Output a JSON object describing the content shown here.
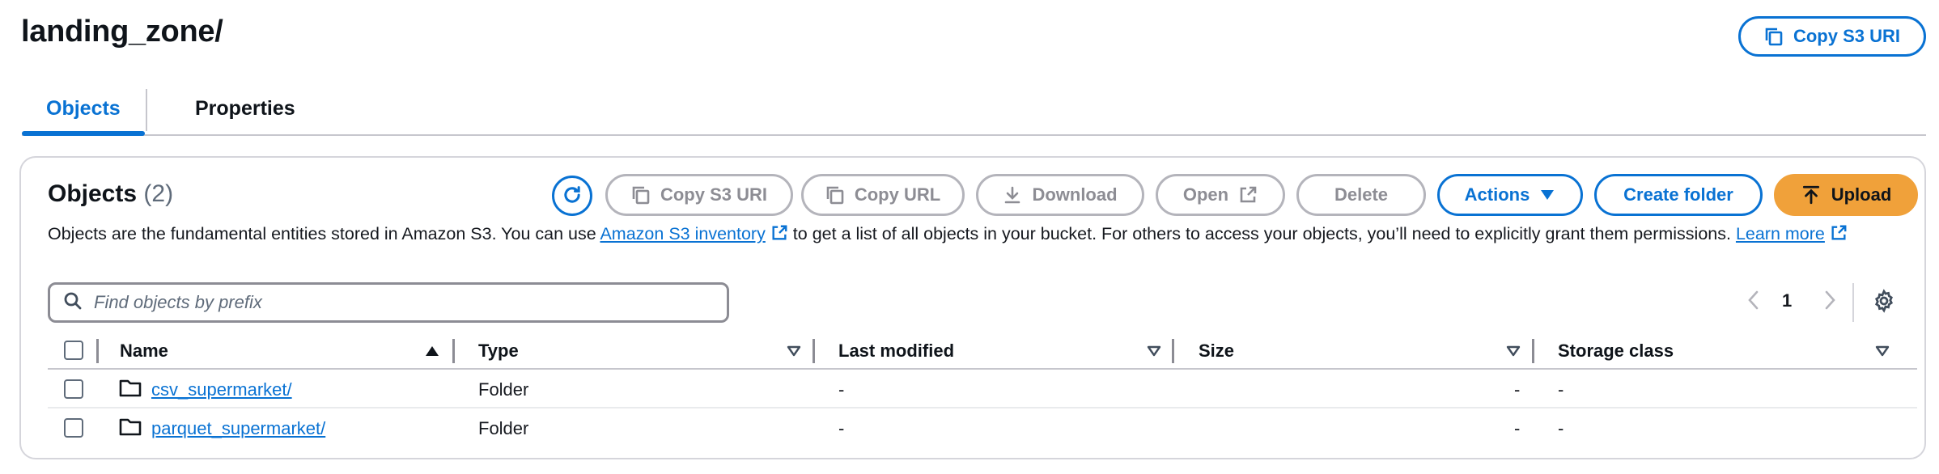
{
  "page": {
    "title": "landing_zone/",
    "copy_s3_uri_label": "Copy S3 URI"
  },
  "tabs": [
    {
      "label": "Objects",
      "active": true
    },
    {
      "label": "Properties",
      "active": false
    }
  ],
  "objects": {
    "heading": "Objects",
    "count": "(2)",
    "toolbar": {
      "copy_s3_uri": "Copy S3 URI",
      "copy_url": "Copy URL",
      "download": "Download",
      "open": "Open",
      "delete": "Delete",
      "actions": "Actions",
      "create_folder": "Create folder",
      "upload": "Upload"
    },
    "description": {
      "part1": "Objects are the fundamental entities stored in Amazon S3. You can use ",
      "inventory_link": "Amazon S3 inventory",
      "part2": " to get a list of all objects in your bucket. For others to access your objects, you’ll need to explicitly grant them permissions. ",
      "learn_more_link": "Learn more"
    },
    "search": {
      "placeholder": "Find objects by prefix",
      "value": ""
    },
    "pagination": {
      "current_page": "1"
    },
    "columns": [
      "Name",
      "Type",
      "Last modified",
      "Size",
      "Storage class"
    ],
    "rows": [
      {
        "name": "csv_supermarket/",
        "type": "Folder",
        "last_modified": "-",
        "size": "-",
        "storage_class": "-"
      },
      {
        "name": "parquet_supermarket/",
        "type": "Folder",
        "last_modified": "-",
        "size": "-",
        "storage_class": "-"
      }
    ]
  },
  "colors": {
    "accent": "#0972d3",
    "upload": "#f0a13a",
    "disabled": "#8d8d94"
  }
}
